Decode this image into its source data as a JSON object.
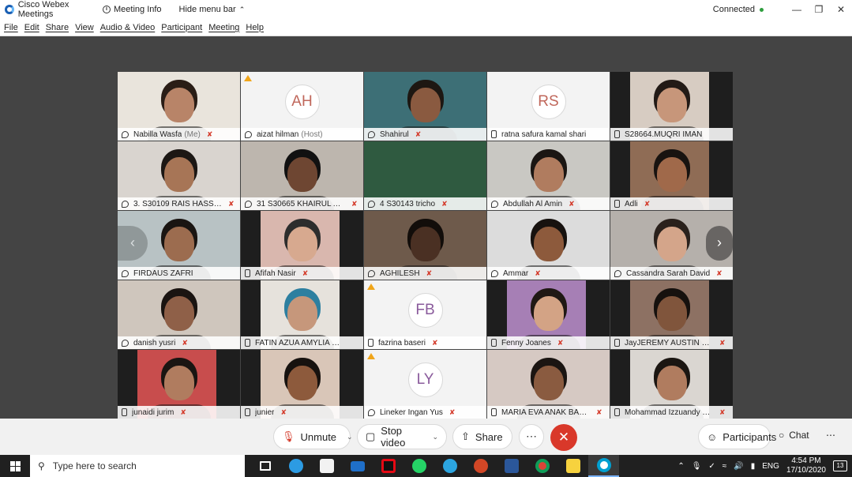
{
  "window": {
    "app_title": "Cisco Webex Meetings",
    "meeting_info": "Meeting Info",
    "hide_menu": "Hide menu bar",
    "status": "Connected"
  },
  "menu": [
    "File",
    "Edit",
    "Share",
    "View",
    "Audio & Video",
    "Participant",
    "Meeting",
    "Help"
  ],
  "participants": [
    {
      "name": "Nabilla Wasfa",
      "sub": "(Me)",
      "kind": "video",
      "icon": "head",
      "mic": true,
      "bg": "#e9e4dc",
      "face": "#b88468",
      "hair": "#2a1d16"
    },
    {
      "name": "aizat hilman",
      "sub": "(Host)",
      "kind": "avatar",
      "initials": "AH",
      "warn": true,
      "icon": "head",
      "mic": false
    },
    {
      "name": "Shahirul",
      "kind": "video",
      "icon": "head",
      "mic": true,
      "bg": "#3d6f76",
      "face": "#8a5a40",
      "hair": "#1d1712"
    },
    {
      "name": "ratna safura kamal shari",
      "kind": "avatar",
      "initials": "RS",
      "icon": "phone",
      "mic": false
    },
    {
      "name": "S28664.MUQRI IMAN",
      "kind": "video",
      "icon": "phone",
      "mic": false,
      "bg": "#d7ccc2",
      "face": "#c7967a",
      "hair": "#221a16",
      "bars": true
    },
    {
      "name": "3. S30109 RAIS HASSAN",
      "kind": "video",
      "icon": "head",
      "mic": true,
      "bg": "#d9d4cf",
      "face": "#a77556",
      "hair": "#1c1714"
    },
    {
      "name": "31 S30665 KHAIRUL ANU...",
      "kind": "video",
      "icon": "head",
      "mic": true,
      "bg": "#bdb6ae",
      "face": "#6e4632",
      "hair": "#111"
    },
    {
      "name": "4 S30143 tricho",
      "kind": "video",
      "icon": "head",
      "mic": true,
      "bg": "#2f5a40",
      "face": null
    },
    {
      "name": "Abdullah Al Amin",
      "kind": "video",
      "icon": "head",
      "mic": true,
      "bg": "#c9c8c3",
      "face": "#b07c5f",
      "hair": "#1b1613"
    },
    {
      "name": "Adli",
      "kind": "video",
      "icon": "phone",
      "mic": true,
      "bg": "#8f6c55",
      "face": "#a0694a",
      "hair": "#181310",
      "bars": true
    },
    {
      "name": "FIRDAUS ZAFRI",
      "kind": "video",
      "icon": "head",
      "mic": false,
      "bg": "#b8c2c4",
      "face": "#9c6c4f",
      "hair": "#1a1512"
    },
    {
      "name": "Afifah Nasir",
      "kind": "video",
      "icon": "phone",
      "mic": true,
      "bg": "#d9b7ae",
      "face": "#d7a98f",
      "hair": "#2d2d2d",
      "bars": true
    },
    {
      "name": "AGHILESH",
      "kind": "video",
      "icon": "head",
      "mic": true,
      "bg": "#6e5a4b",
      "face": "#4a3023",
      "hair": "#120d0a"
    },
    {
      "name": "Ammar",
      "kind": "video",
      "icon": "head",
      "mic": true,
      "bg": "#dcdcdc",
      "face": "#8d5a3c",
      "hair": "#17120f"
    },
    {
      "name": "Cassandra Sarah David",
      "kind": "video",
      "icon": "head",
      "mic": true,
      "bg": "#b5b0ab",
      "face": "#d4a58a",
      "hair": "#2a211c"
    },
    {
      "name": "danish yusri",
      "kind": "video",
      "icon": "head",
      "mic": true,
      "bg": "#cfc6bd",
      "face": "#8f6048",
      "hair": "#1a1411"
    },
    {
      "name": "FATIN AZUA AMYLIA BIN...",
      "kind": "video",
      "icon": "phone",
      "mic": false,
      "bg": "#e6e2dc",
      "face": "#c6977b",
      "hair": "#2d7fa0",
      "bars": true
    },
    {
      "name": "fazrina baseri",
      "kind": "avatar",
      "initials": "FB",
      "warn": true,
      "icon": "phone",
      "mic": true
    },
    {
      "name": "Fenny Joanes",
      "kind": "video",
      "icon": "phone",
      "mic": true,
      "bg": "#a67fb5",
      "face": "#d3a385",
      "hair": "#1f1814",
      "bars": true
    },
    {
      "name": "JayJEREMY AUSTIN S293...",
      "kind": "video",
      "icon": "phone",
      "mic": true,
      "bg": "#8d7163",
      "face": "#80553c",
      "hair": "#16110e",
      "bars": true
    },
    {
      "name": "junaidi jurim",
      "kind": "video",
      "icon": "phone",
      "mic": true,
      "bg": "#c84d4d",
      "face": "#b07c5f",
      "hair": "#1a1512",
      "bars": true
    },
    {
      "name": "junier",
      "kind": "video",
      "icon": "phone",
      "mic": true,
      "bg": "#d9c6b8",
      "face": "#8d5a3c",
      "hair": "#17120f",
      "bars": true
    },
    {
      "name": "Lineker Ingan Yus",
      "kind": "avatar",
      "initials": "LY",
      "warn": true,
      "icon": "head",
      "mic": true
    },
    {
      "name": "MARIA EVA ANAK BARUDI",
      "kind": "video",
      "icon": "phone",
      "mic": true,
      "bg": "#d6c9c3",
      "face": "#8a5b40",
      "hair": "#1b1512"
    },
    {
      "name": "Mohammad Izzuandy Yu...",
      "kind": "video",
      "icon": "phone",
      "mic": true,
      "bg": "#dad6d1",
      "face": "#b07c5f",
      "hair": "#1b1612",
      "bars": true
    }
  ],
  "controls": {
    "unmute": "Unmute",
    "stop_video": "Stop video",
    "share": "Share",
    "more": "⋯",
    "end": "✕",
    "participants": "Participants",
    "chat": "Chat"
  },
  "taskbar": {
    "search_placeholder": "Type here to search",
    "lang": "ENG",
    "time": "4:54 PM",
    "date": "17/10/2020",
    "notif_count": "13"
  },
  "mic_glyph": "̸",
  "nav": {
    "prev": "‹",
    "next": "›"
  }
}
